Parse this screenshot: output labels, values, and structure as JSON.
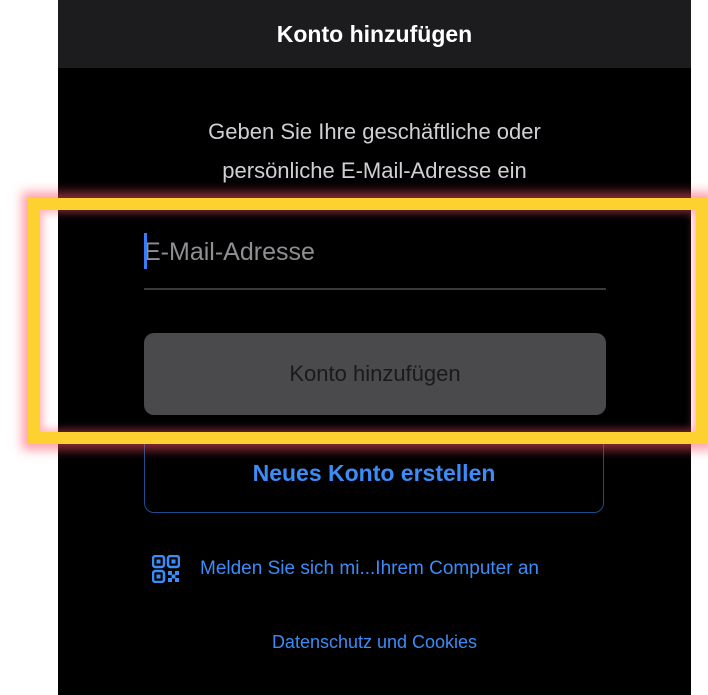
{
  "nav": {
    "title": "Konto hinzufügen"
  },
  "instruction": {
    "line1": "Geben Sie Ihre geschäftliche oder",
    "line2": "persönliche E-Mail-Adresse ein"
  },
  "email": {
    "placeholder": "E-Mail-Adresse",
    "value": ""
  },
  "buttons": {
    "add_account": "Konto hinzufügen",
    "create_account": "Neues Konto erstellen"
  },
  "qr_signin": {
    "icon": "qr-code-icon",
    "label": "Melden Sie sich mi...Ihrem Computer an"
  },
  "footer": {
    "privacy_link": "Datenschutz und Cookies"
  },
  "colors": {
    "background": "#000000",
    "nav_background": "#1c1c1e",
    "accent_blue": "#3b8cf7",
    "highlight_yellow": "#fdd130",
    "highlight_glow": "#ff5064"
  }
}
